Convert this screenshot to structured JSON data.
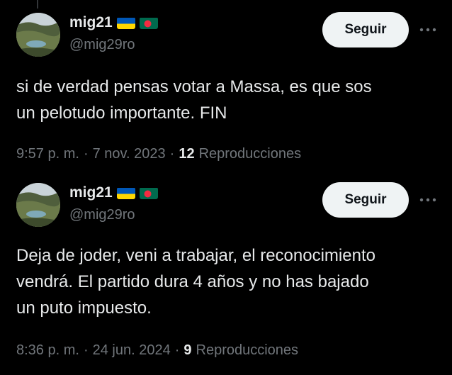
{
  "tweets": [
    {
      "display_name": "mig21",
      "handle": "@mig29ro",
      "follow_label": "Seguir",
      "text": "si de verdad pensas votar a Massa, es que sos\nun pelotudo importante. FIN",
      "time": "9:57 p. m.",
      "date": "7 nov. 2023",
      "views_count": "12",
      "views_label": "Reproducciones",
      "separator": "·"
    },
    {
      "display_name": "mig21",
      "handle": "@mig29ro",
      "follow_label": "Seguir",
      "text": "Deja de joder,  veni a trabajar, el reconocimiento\nvendrá. El partido dura 4 años y no has bajado\nun puto impuesto.",
      "time": "8:36 p. m.",
      "date": "24 jun. 2024",
      "views_count": "9",
      "views_label": "Reproducciones",
      "separator": "·"
    }
  ],
  "colors": {
    "background": "#000000",
    "primary_text": "#e7e9ea",
    "secondary_text": "#71767b",
    "button_bg": "#eff3f4",
    "button_text": "#0f1419"
  },
  "icons": {
    "flag_1": "ukraine-flag-icon",
    "flag_2": "bangladesh-flag-icon",
    "more": "more-options-icon"
  }
}
